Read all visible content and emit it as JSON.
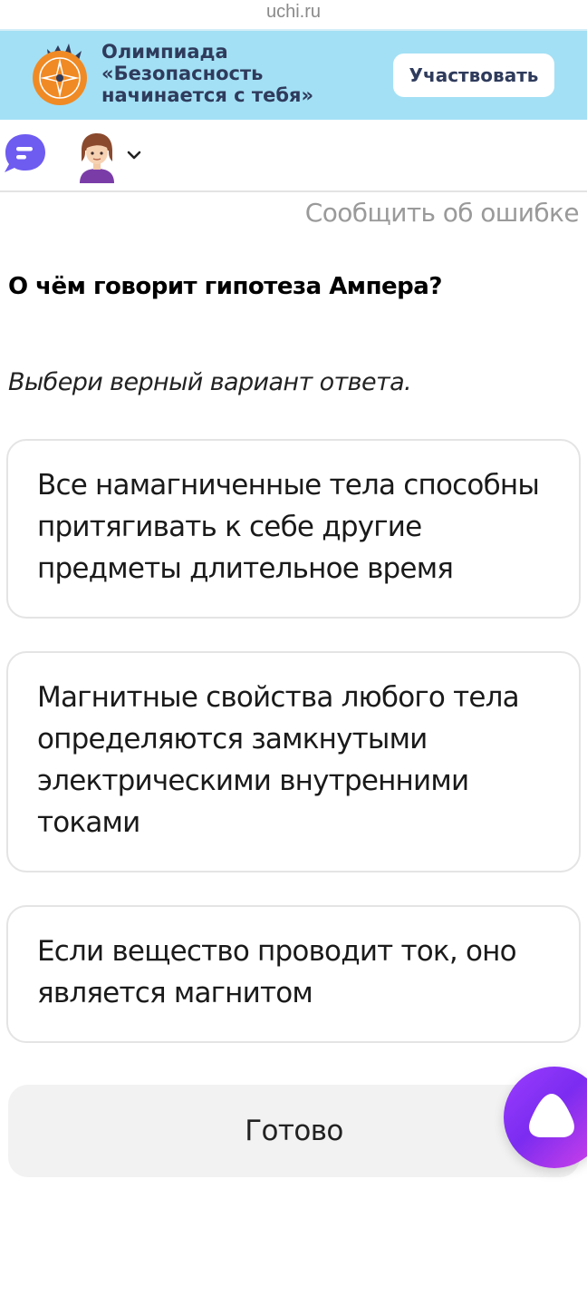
{
  "browser": {
    "url": "uchi.ru"
  },
  "banner": {
    "title_lines": [
      "Олимпиада",
      "«Безопасность",
      "начинается с тебя»"
    ],
    "cta_label": "Участвовать"
  },
  "report_error_label": "Сообщить об ошибке",
  "question": "О чём говорит гипотеза Ампера?",
  "instruction": "Выбери верный вариант ответа.",
  "options": [
    {
      "lines": [
        "Все намагниченные тела способны",
        "притягивать к себе другие",
        "предметы длительное время"
      ]
    },
    {
      "lines": [
        "Магнитные свойства любого тела",
        "определяются замкнутыми",
        "электрическими внутренними",
        "токами"
      ]
    },
    {
      "lines": [
        "Если вещество проводит ток, оно",
        "является магнитом"
      ]
    }
  ],
  "done_label": "Готово",
  "colors": {
    "banner_bg": "#a3e0f5",
    "chat_icon": "#6e5cf0",
    "assistant_gradient": [
      "#9b3dff",
      "#d642e8"
    ]
  },
  "icons": {
    "logo": "compass-star-logo",
    "chat": "chat-bubble-icon",
    "avatar": "user-avatar",
    "chevron": "chevron-down-icon",
    "assistant": "alice-assistant-icon"
  }
}
